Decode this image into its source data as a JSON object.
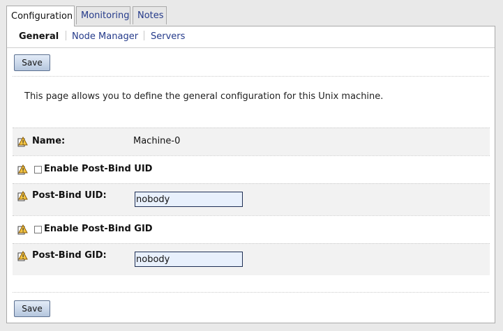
{
  "tabs": [
    {
      "label": "Configuration",
      "active": true
    },
    {
      "label": "Monitoring",
      "active": false
    },
    {
      "label": "Notes",
      "active": false
    }
  ],
  "subtabs": [
    {
      "label": "General",
      "active": true
    },
    {
      "label": "Node Manager",
      "active": false
    },
    {
      "label": "Servers",
      "active": false
    }
  ],
  "save_label": "Save",
  "description": "This page allows you to define the general configuration for this Unix machine.",
  "fields": {
    "name": {
      "label": "Name:",
      "value": "Machine-0"
    },
    "enable_uid": {
      "label": "Enable Post-Bind UID",
      "checked": false
    },
    "uid": {
      "label": "Post-Bind UID:",
      "value": "nobody"
    },
    "enable_gid": {
      "label": "Enable Post-Bind GID",
      "checked": false
    },
    "gid": {
      "label": "Post-Bind GID:",
      "value": "nobody"
    }
  },
  "icon": "help-warning-icon",
  "colors": {
    "link": "#243a8a",
    "input_bg": "#e8f0fc",
    "row_shade": "#f2f2f2"
  }
}
